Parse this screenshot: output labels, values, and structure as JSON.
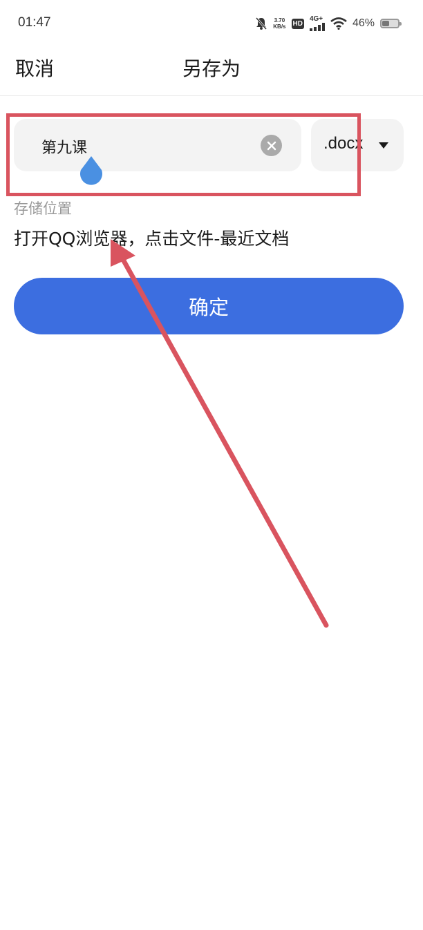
{
  "status_bar": {
    "time": "01:47",
    "net_speed_value": "3.70",
    "net_speed_unit": "KB/s",
    "hd": "HD",
    "network": "4G+",
    "battery_percent": "46%",
    "battery_level": 0.46,
    "icons": [
      "bell-off-icon",
      "signal-icon",
      "wifi-icon",
      "battery-icon"
    ]
  },
  "header": {
    "cancel_label": "取消",
    "title": "另存为"
  },
  "filename": {
    "value": "第九课",
    "clear_icon": "clear-icon",
    "extension": ".docx",
    "extension_icon": "dropdown-caret-icon"
  },
  "storage": {
    "label": "存储位置",
    "value": "打开QQ浏览器，点击文件-最近文档"
  },
  "confirm_label": "确定",
  "annotation": {
    "box_color": "#d9545f",
    "arrow_color": "#d9545f"
  },
  "colors": {
    "primary": "#3c6ee0",
    "caret_handle": "#4a90e2"
  }
}
